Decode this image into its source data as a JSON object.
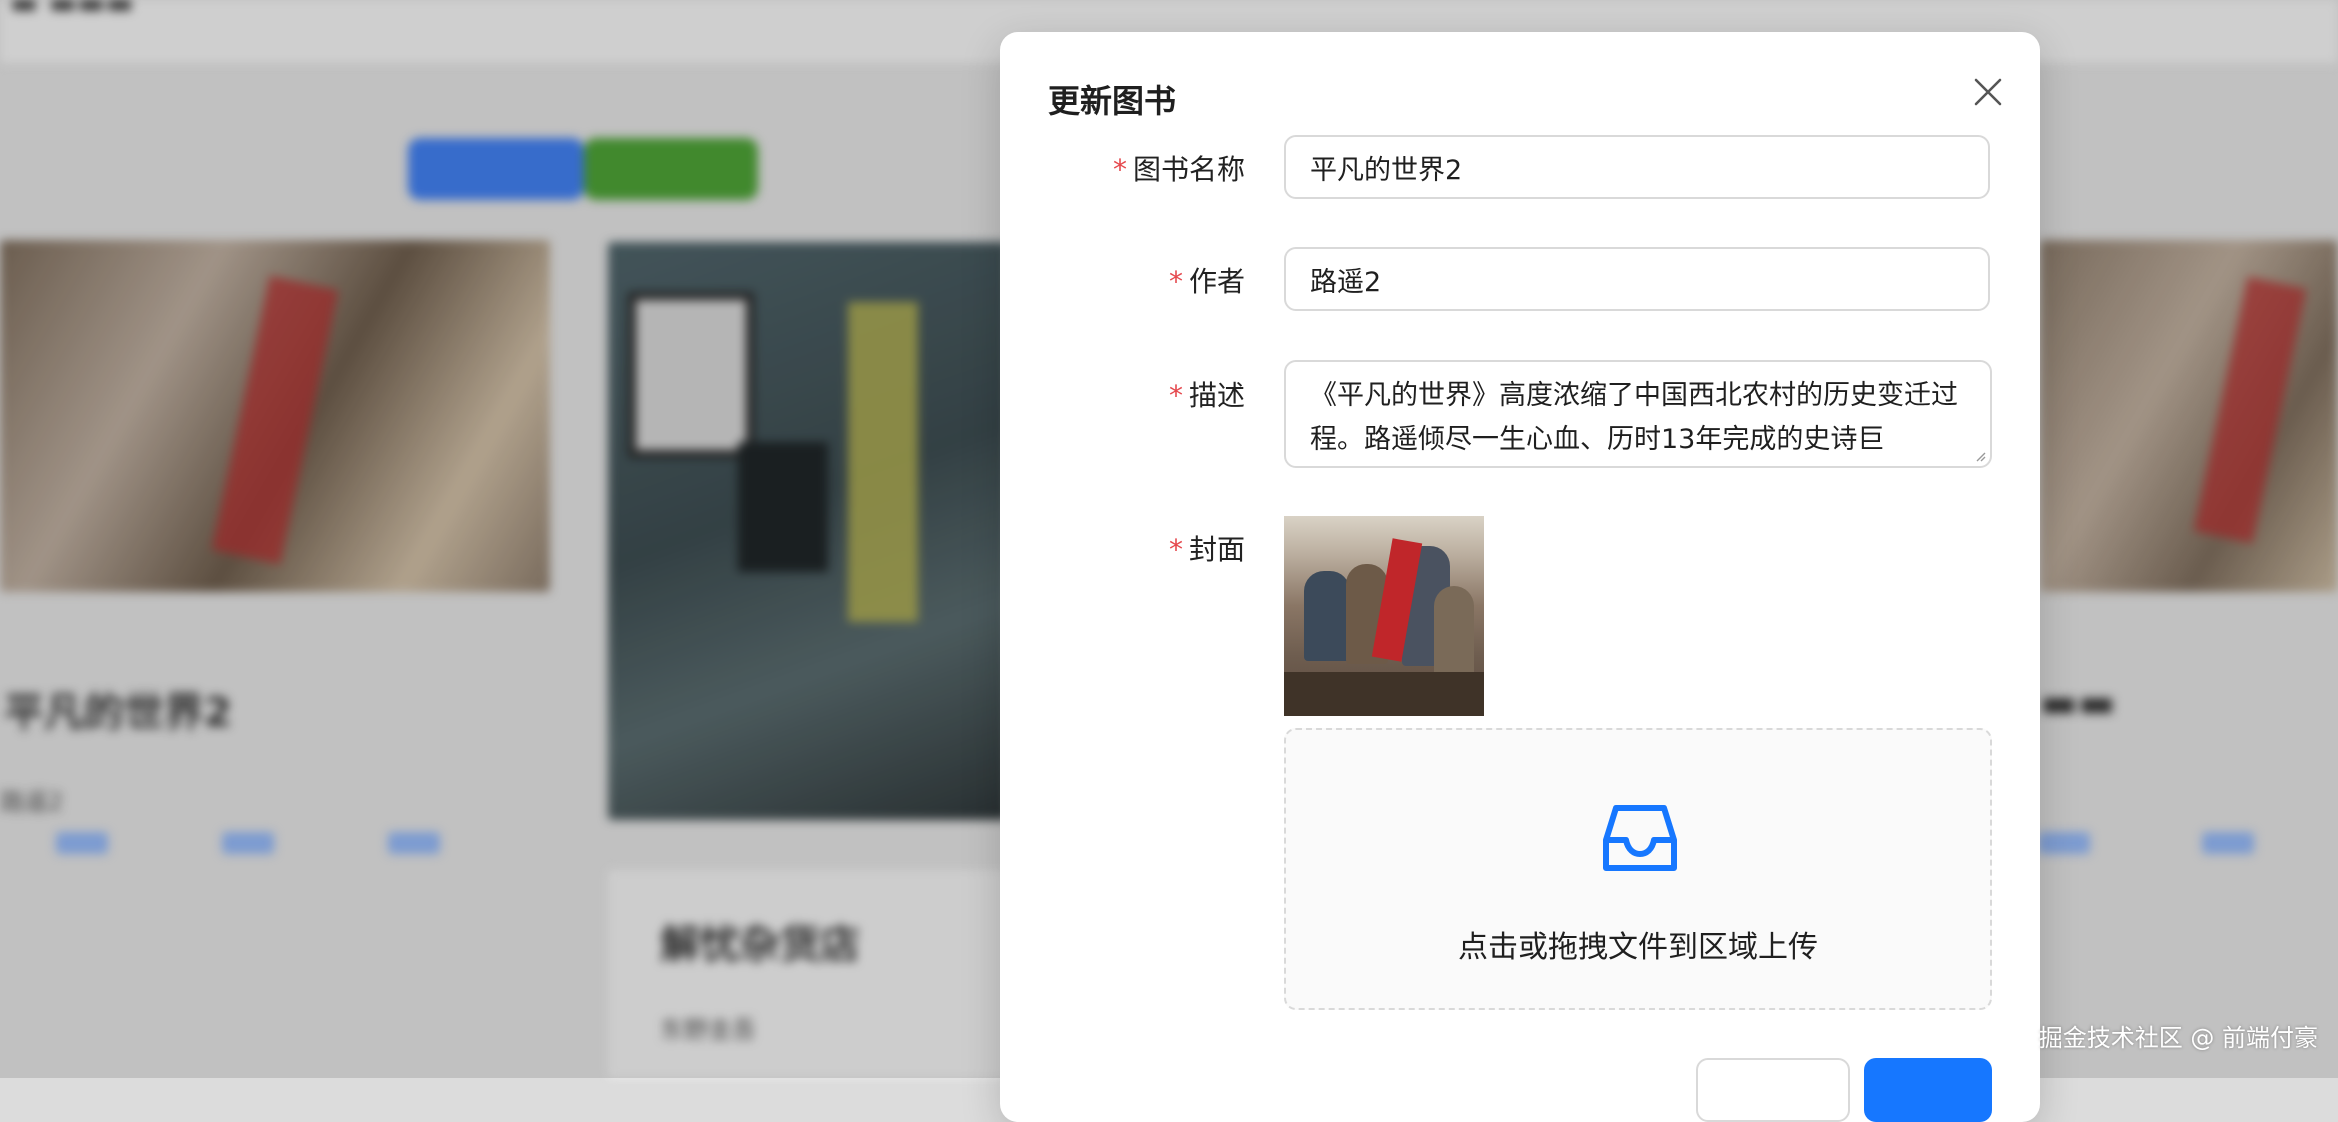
{
  "background": {
    "cards": [
      {
        "title": "平凡的世界2",
        "subtitle": "路遥2"
      },
      {
        "title": "解忧杂货店",
        "subtitle": "东野圭吾"
      }
    ],
    "buttons": [
      "",
      ""
    ]
  },
  "modal": {
    "title": "更新图书",
    "fields": {
      "name": {
        "label": "图书名称",
        "value": "平凡的世界2"
      },
      "author": {
        "label": "作者",
        "value": "路遥2"
      },
      "description": {
        "label": "描述",
        "value": "《平凡的世界》高度浓缩了中国西北农村的历史变迁过程。路遥倾尽一生心血、历时13年完成的史诗巨"
      },
      "cover": {
        "label": "封面"
      }
    },
    "required_mark": "*",
    "upload": {
      "text": "点击或拖拽文件到区域上传",
      "icon": "inbox-icon"
    },
    "close_icon": "close-icon"
  },
  "watermark": "掘金技术社区 @ 前端付豪",
  "colors": {
    "primary": "#1677ff",
    "required": "#e5484d",
    "mask": "rgba(0,0,0,0.12)"
  }
}
